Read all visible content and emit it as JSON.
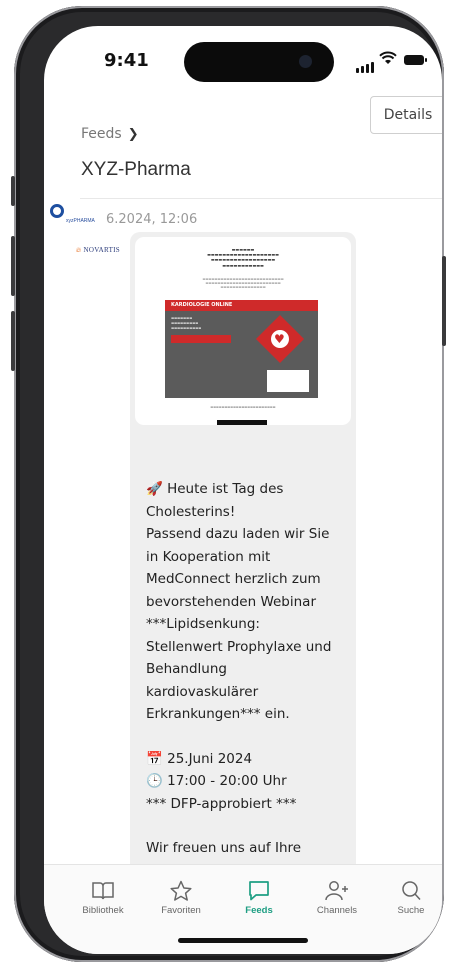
{
  "status": {
    "time": "9:41"
  },
  "header": {
    "breadcrumb": "Feeds",
    "details_label": "Details",
    "title": "XYZ-Pharma"
  },
  "post": {
    "sender_label": "xyzPHARMA",
    "date": "6.2024, 12:06",
    "sponsor": "NOVARTIS",
    "banner_title": "KARDIOLOGIE ONLINE",
    "message_lines": [
      "🚀 Heute ist Tag des",
      "Cholesterins!",
      "Passend dazu laden wir Sie",
      "in Kooperation mit",
      "MedConnect herzlich zum",
      "bevorstehenden Webinar",
      "***Lipidsenkung:",
      "Stellenwert Prophylaxe und",
      "Behandlung",
      "kardiovaskulärer",
      "Erkrankungen*** ein."
    ],
    "event_lines": [
      "📅 25.Juni 2024",
      "🕒 17:00 - 20:00 Uhr",
      "*** DFP-approbiert ***"
    ],
    "closing_line": "Wir freuen uns auf Ihre"
  },
  "tabs": [
    {
      "label": "Bibliothek",
      "icon": "book-icon",
      "active": false
    },
    {
      "label": "Favoriten",
      "icon": "star-icon",
      "active": false
    },
    {
      "label": "Feeds",
      "icon": "chat-bubble-icon",
      "active": true
    },
    {
      "label": "Channels",
      "icon": "add-person-icon",
      "active": false
    },
    {
      "label": "Suche",
      "icon": "search-icon",
      "active": false
    }
  ],
  "colors": {
    "accent": "#1e9e83",
    "brand_blue": "#1e4fa0",
    "banner_red": "#cf2a2a"
  }
}
